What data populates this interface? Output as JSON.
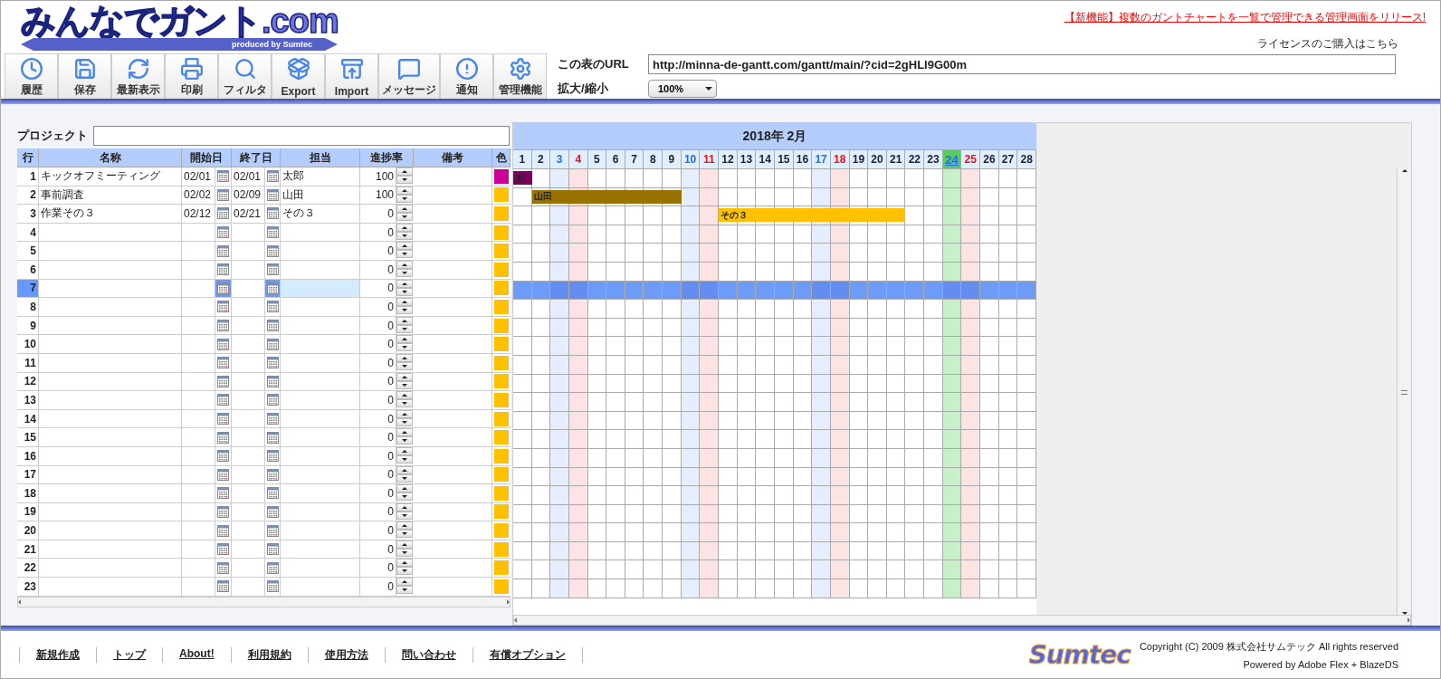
{
  "logo": {
    "title": "みんなでガント.com",
    "tagline": "produced by Sumtec"
  },
  "announcement": "【新機能】複数のガントチャートを一覧で管理できる管理画面をリリース!",
  "license_link": "ライセンスのご購入はこちら",
  "toolbar": [
    "履歴",
    "保存",
    "最新表示",
    "印刷",
    "フィルタ",
    "Export",
    "Import",
    "メッセージ",
    "通知",
    "管理機能"
  ],
  "url_field": {
    "label": "この表のURL",
    "value": "http://minna-de-gantt.com/gantt/main/?cid=2gHLI9G00m"
  },
  "zoom": {
    "label": "拡大/縮小",
    "value": "100%"
  },
  "project": {
    "label": "プロジェクト"
  },
  "columns": [
    "行",
    "名称",
    "開始日",
    "終了日",
    "担当",
    "進捗率",
    "備考",
    "色"
  ],
  "month": "2018年 2月",
  "days": [
    {
      "label": "1",
      "kind": "weekday"
    },
    {
      "label": "2",
      "kind": "weekday"
    },
    {
      "label": "3",
      "kind": "saturday"
    },
    {
      "label": "4",
      "kind": "sunday"
    },
    {
      "label": "5",
      "kind": "weekday"
    },
    {
      "label": "6",
      "kind": "weekday"
    },
    {
      "label": "7",
      "kind": "weekday"
    },
    {
      "label": "8",
      "kind": "weekday"
    },
    {
      "label": "9",
      "kind": "weekday"
    },
    {
      "label": "10",
      "kind": "saturday"
    },
    {
      "label": "11",
      "kind": "sunday"
    },
    {
      "label": "12",
      "kind": "weekday"
    },
    {
      "label": "13",
      "kind": "weekday"
    },
    {
      "label": "14",
      "kind": "weekday"
    },
    {
      "label": "15",
      "kind": "weekday"
    },
    {
      "label": "16",
      "kind": "weekday"
    },
    {
      "label": "17",
      "kind": "saturday"
    },
    {
      "label": "18",
      "kind": "sunday"
    },
    {
      "label": "19",
      "kind": "weekday"
    },
    {
      "label": "20",
      "kind": "weekday"
    },
    {
      "label": "21",
      "kind": "weekday"
    },
    {
      "label": "22",
      "kind": "weekday"
    },
    {
      "label": "23",
      "kind": "weekday"
    },
    {
      "label": "24",
      "kind": "today"
    },
    {
      "label": "25",
      "kind": "sunday"
    },
    {
      "label": "26",
      "kind": "weekday"
    },
    {
      "label": "27",
      "kind": "weekday"
    },
    {
      "label": "28",
      "kind": "weekday"
    }
  ],
  "rows": [
    {
      "no": "1",
      "name": "キックオフミーティング",
      "start": "02/01",
      "end": "02/01",
      "owner": "太郎",
      "progress": "100",
      "color": "#cc0099",
      "bar_label": "太",
      "selected": false
    },
    {
      "no": "2",
      "name": "事前調査",
      "start": "02/02",
      "end": "02/09",
      "owner": "山田",
      "progress": "100",
      "color": "#ffc000",
      "bar_label": "山田",
      "selected": false
    },
    {
      "no": "3",
      "name": "作業その３",
      "start": "02/12",
      "end": "02/21",
      "owner": "その３",
      "progress": "0",
      "color": "#ffc000",
      "bar_label": "その３",
      "selected": false
    },
    {
      "no": "4",
      "progress": "0",
      "color": "#ffc000",
      "selected": false
    },
    {
      "no": "5",
      "progress": "0",
      "color": "#ffc000",
      "selected": false
    },
    {
      "no": "6",
      "progress": "0",
      "color": "#ffc000",
      "selected": false
    },
    {
      "no": "7",
      "progress": "0",
      "color": "#ffc000",
      "selected": true
    },
    {
      "no": "8",
      "progress": "0",
      "color": "#ffc000",
      "selected": false
    },
    {
      "no": "9",
      "progress": "0",
      "color": "#ffc000",
      "selected": false
    },
    {
      "no": "10",
      "progress": "0",
      "color": "#ffc000",
      "selected": false
    },
    {
      "no": "11",
      "progress": "0",
      "color": "#ffc000",
      "selected": false
    },
    {
      "no": "12",
      "progress": "0",
      "color": "#ffc000",
      "selected": false
    },
    {
      "no": "13",
      "progress": "0",
      "color": "#ffc000",
      "selected": false
    },
    {
      "no": "14",
      "progress": "0",
      "color": "#ffc000",
      "selected": false
    },
    {
      "no": "15",
      "progress": "0",
      "color": "#ffc000",
      "selected": false
    },
    {
      "no": "16",
      "progress": "0",
      "color": "#ffc000",
      "selected": false
    },
    {
      "no": "17",
      "progress": "0",
      "color": "#ffc000",
      "selected": false
    },
    {
      "no": "18",
      "progress": "0",
      "color": "#ffc000",
      "selected": false
    },
    {
      "no": "19",
      "progress": "0",
      "color": "#ffc000",
      "selected": false
    },
    {
      "no": "20",
      "progress": "0",
      "color": "#ffc000",
      "selected": false
    },
    {
      "no": "21",
      "progress": "0",
      "color": "#ffc000",
      "selected": false
    },
    {
      "no": "22",
      "progress": "0",
      "color": "#ffc000",
      "selected": false
    },
    {
      "no": "23",
      "progress": "0",
      "color": "#ffc000",
      "selected": false
    }
  ],
  "footer_links": [
    "新規作成",
    "トップ",
    "About!",
    "利用規約",
    "使用方法",
    "問い合わせ",
    "有償オプション"
  ],
  "footer_logo": "Sumtec",
  "copyright": "Copyright (C) 2009 株式会社サムテック All rights reserved",
  "powered_by": "Powered by Adobe Flex + BlazeDS"
}
